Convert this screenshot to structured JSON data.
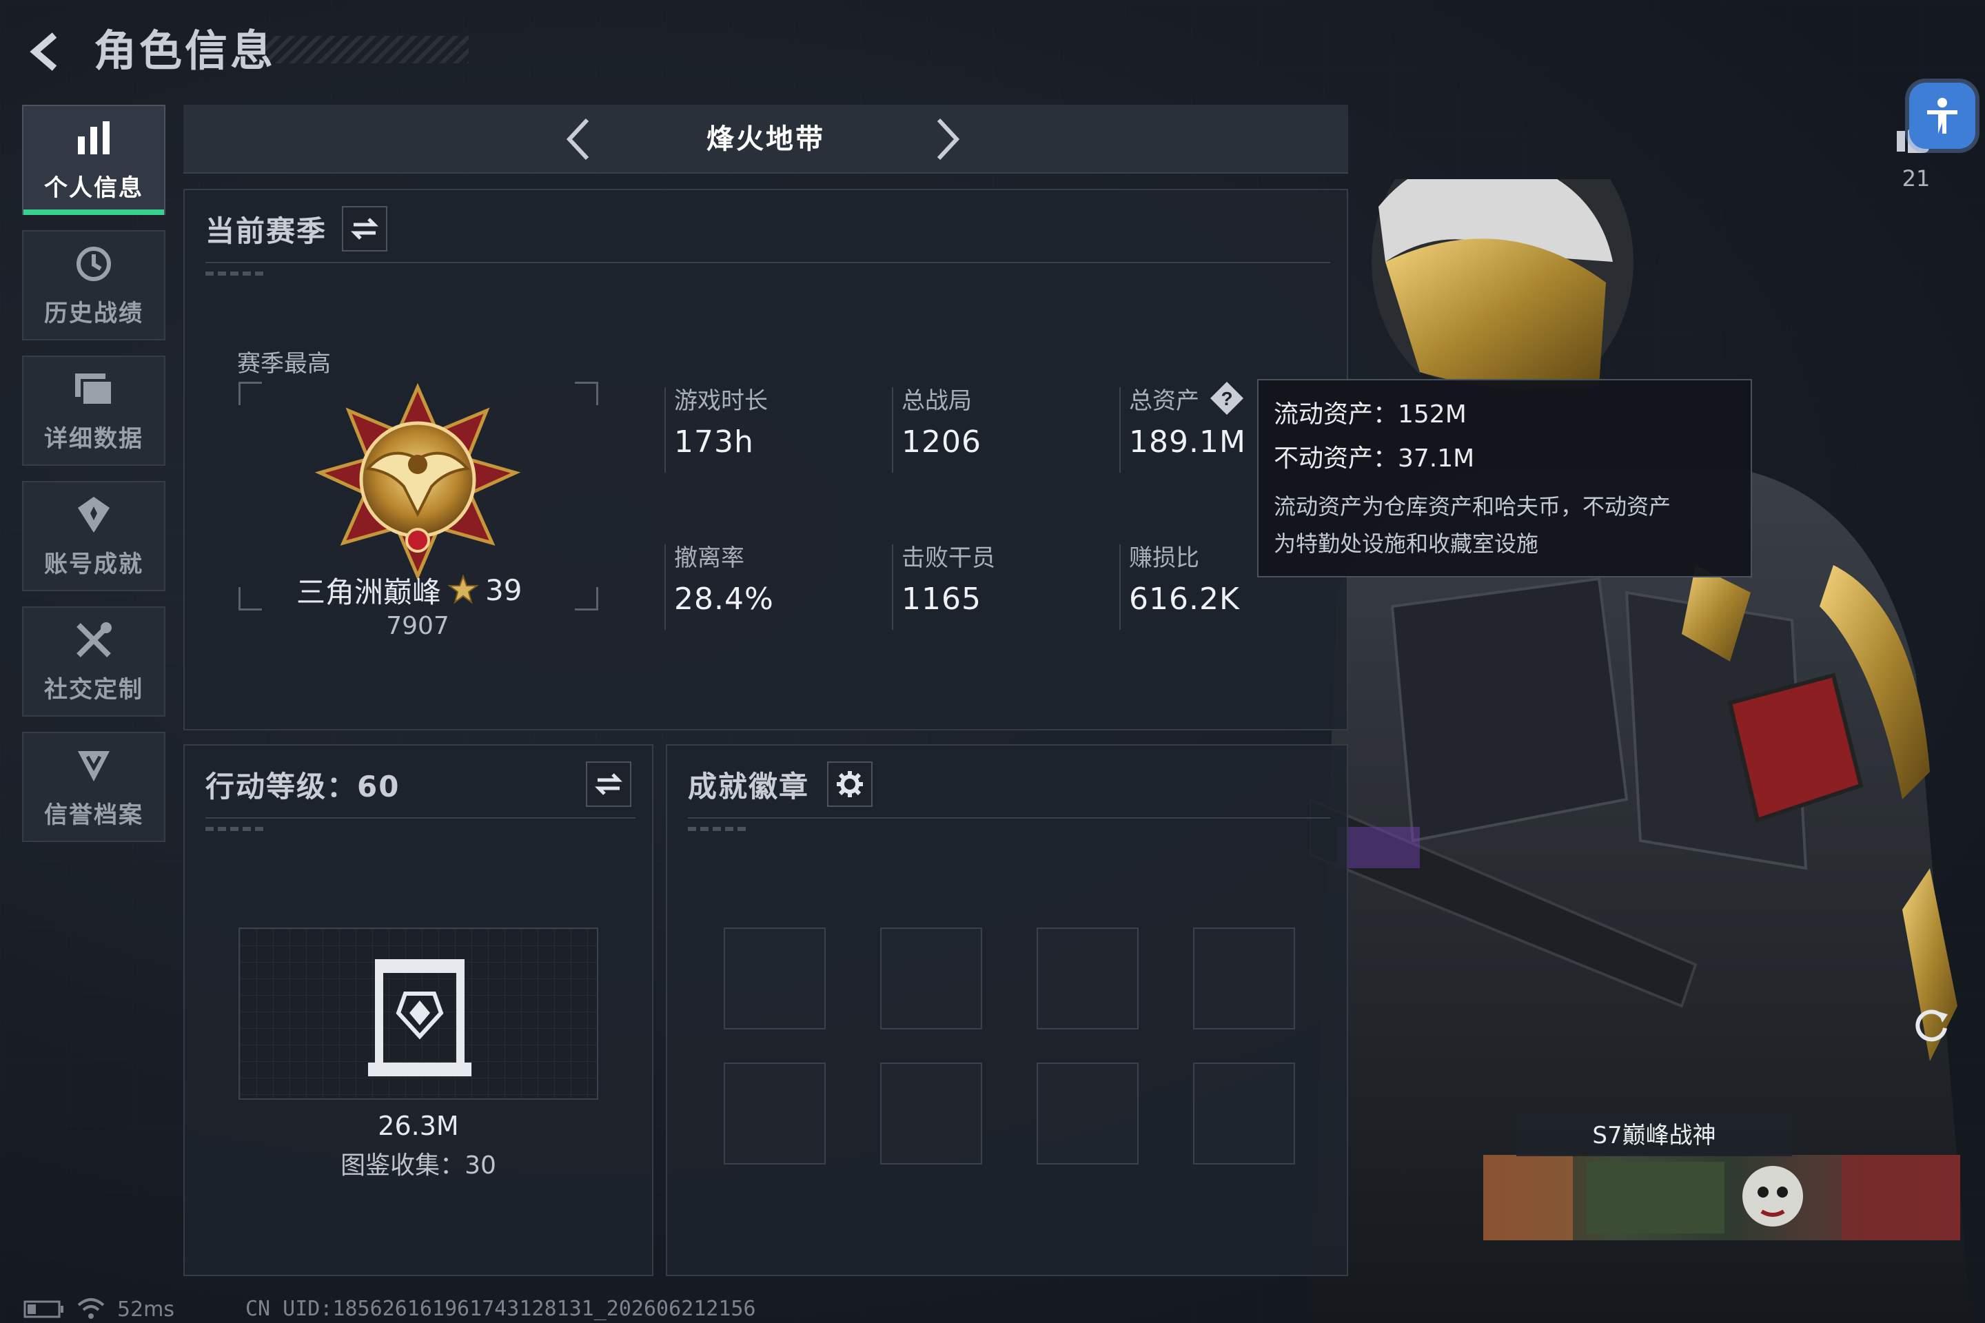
{
  "header": {
    "title": "角色信息"
  },
  "sidebar": {
    "items": [
      {
        "label": "个人信息",
        "icon": "bar-chart-icon",
        "active": true
      },
      {
        "label": "历史战绩",
        "icon": "history-icon"
      },
      {
        "label": "详细数据",
        "icon": "folder-icon"
      },
      {
        "label": "账号成就",
        "icon": "achievement-icon"
      },
      {
        "label": "社交定制",
        "icon": "tools-icon"
      },
      {
        "label": "信誉档案",
        "icon": "shield-icon"
      }
    ]
  },
  "mode": {
    "title": "烽火地带"
  },
  "season": {
    "title": "当前赛季",
    "best_label": "赛季最高",
    "rank_name": "三角洲巅峰",
    "rank_stars": "39",
    "rank_score": "7907",
    "stats": [
      {
        "label": "游戏时长",
        "value": "173h"
      },
      {
        "label": "总战局",
        "value": "1206"
      },
      {
        "label": "总资产",
        "value": "189.1M"
      },
      {
        "label": "撤离率",
        "value": "28.4%"
      },
      {
        "label": "击败干员",
        "value": "1165"
      },
      {
        "label": "赚损比",
        "value": "616.2K"
      }
    ]
  },
  "tooltip": {
    "liquid": "流动资产：152M",
    "fixed": "不动资产：37.1M",
    "note_line1": "流动资产为仓库资产和哈夫币，不动资产",
    "note_line2": "为特勤处设施和收藏室设施"
  },
  "action": {
    "title": "行动等级：60",
    "value": "26.3M",
    "collection": "图鉴收集：30"
  },
  "badges": {
    "title": "成就徽章"
  },
  "likes": {
    "count": "21"
  },
  "title_card": {
    "name": "S7巅峰战神"
  },
  "status": {
    "ping": "52ms",
    "uid": "CN UID:18562616196174312813​1_202606212156"
  },
  "colors": {
    "accent": "#38d18e",
    "panel": "#1e232c",
    "access": "#3f7ed6"
  }
}
